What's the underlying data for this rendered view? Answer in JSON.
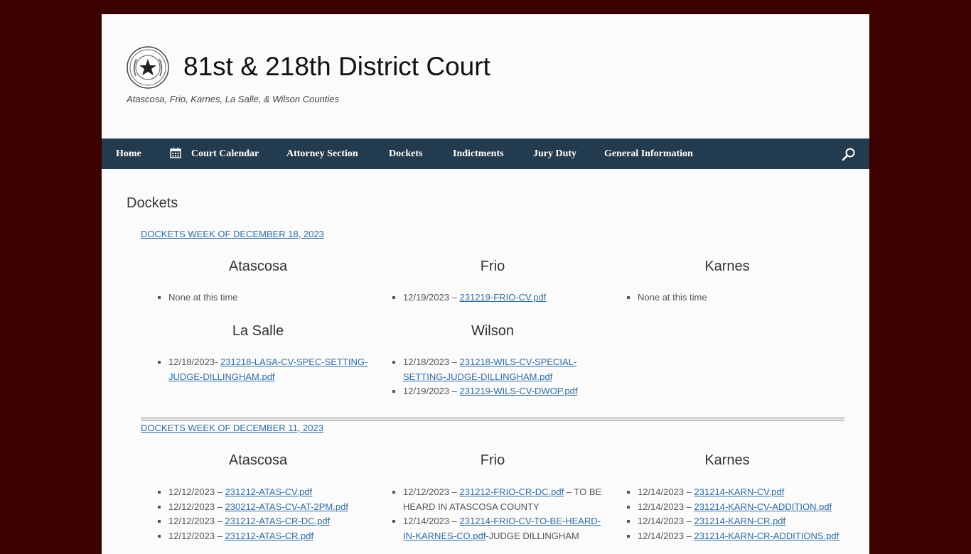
{
  "site": {
    "title": "81st & 218th District Court",
    "tagline": "Atascosa, Frio, Karnes, La Salle, & Wilson Counties",
    "seal_icon": "texas-state-seal"
  },
  "nav": {
    "items": [
      {
        "label": "Home"
      },
      {
        "label": "Court Calendar",
        "icon": "calendar-icon"
      },
      {
        "label": "Attorney Section"
      },
      {
        "label": "Dockets"
      },
      {
        "label": "Indictments"
      },
      {
        "label": "Jury Duty"
      },
      {
        "label": "General Information"
      }
    ],
    "search_icon": "search-icon"
  },
  "page": {
    "title": "Dockets"
  },
  "weeks": [
    {
      "link": "DOCKETS WEEK OF DECEMBER 18, 2023",
      "counties": {
        "atascosa": {
          "name": "Atascosa",
          "items": [
            {
              "text": "None at this time"
            }
          ]
        },
        "frio": {
          "name": "Frio",
          "items": [
            {
              "prefix": "12/19/2023 – ",
              "file": "231219-FRIO-CV.pdf"
            }
          ]
        },
        "karnes": {
          "name": "Karnes",
          "items": [
            {
              "text": "None at this time"
            }
          ]
        },
        "lasalle": {
          "name": "La Salle",
          "items": [
            {
              "prefix": "12/18/2023- ",
              "file": "231218-LASA-CV-SPEC-SETTING-JUDGE-DILLINGHAM.pdf"
            }
          ]
        },
        "wilson": {
          "name": "Wilson",
          "items": [
            {
              "prefix": "12/18/2023 – ",
              "file": "231218-WILS-CV-SPECIAL-SETTING-JUDGE-DILLINGHAM.pdf"
            },
            {
              "prefix": "12/19/2023 – ",
              "file": "231219-WILS-CV-DWOP.pdf"
            }
          ]
        }
      }
    },
    {
      "link": "DOCKETS WEEK OF DECEMBER 11, 2023",
      "counties": {
        "atascosa": {
          "name": "Atascosa",
          "items": [
            {
              "prefix": "12/12/2023 – ",
              "file": "231212-ATAS-CV.pdf"
            },
            {
              "prefix": "12/12/2023 – ",
              "file": "230212-ATAS-CV-AT-2PM.pdf"
            },
            {
              "prefix": "12/12/2023 – ",
              "file": "231212-ATAS-CR-DC.pdf"
            },
            {
              "prefix": "12/12/2023 – ",
              "file": "231212-ATAS-CR.pdf"
            }
          ]
        },
        "frio": {
          "name": "Frio",
          "items": [
            {
              "prefix": "12/12/2023 – ",
              "file": "231212-FRIO-CR-DC.pdf",
              "suffix": " – TO BE HEARD IN ATASCOSA COUNTY"
            },
            {
              "prefix": "12/14/2023 – ",
              "file": "231214-FRIO-CV-TO-BE-HEARD-IN-KARNES-CO.pdf",
              "suffix": "-JUDGE DILLINGHAM"
            }
          ]
        },
        "karnes": {
          "name": "Karnes",
          "items": [
            {
              "prefix": "12/14/2023 – ",
              "file": "231214-KARN-CV.pdf"
            },
            {
              "prefix": "12/14/2023 – ",
              "file": "231214-KARN-CV-ADDITION.pdf"
            },
            {
              "prefix": "12/14/2023 – ",
              "file": "231214-KARN-CR.pdf"
            },
            {
              "prefix": "12/14/2023 – ",
              "file": "231214-KARN-CR-ADDITIONS.pdf"
            }
          ]
        }
      }
    }
  ]
}
